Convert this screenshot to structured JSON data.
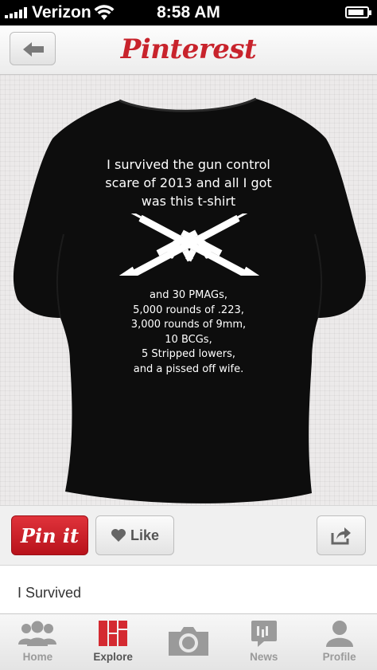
{
  "status_bar": {
    "carrier": "Verizon",
    "time": "8:58 AM",
    "battery_level": 0.85
  },
  "nav": {
    "back_icon": "back-arrow-icon",
    "brand": "Pinterest"
  },
  "pin": {
    "shirt_headline": [
      "I survived the gun control",
      "scare of 2013 and all I got",
      "was this t-shirt"
    ],
    "shirt_list": [
      "and 30 PMAGs,",
      "5,000 rounds of .223,",
      "3,000 rounds of 9mm,",
      "10 BCGs,",
      "5 Stripped lowers,",
      "and a pissed off wife."
    ],
    "description": "I Survived"
  },
  "actions": {
    "pin_it_label": "Pin it",
    "like_label": "Like",
    "like_icon": "heart-icon",
    "share_icon": "share-icon"
  },
  "tabs": [
    {
      "label": "Home",
      "icon": "people-icon",
      "active": false
    },
    {
      "label": "Explore",
      "icon": "grid-icon",
      "active": true
    },
    {
      "label": "",
      "icon": "camera-icon",
      "active": false
    },
    {
      "label": "News",
      "icon": "news-icon",
      "active": false
    },
    {
      "label": "Profile",
      "icon": "person-icon",
      "active": false
    }
  ],
  "colors": {
    "brand_red": "#c8232c",
    "pin_button_red": "#cc1f28",
    "shirt_black": "#0d0d0d"
  }
}
